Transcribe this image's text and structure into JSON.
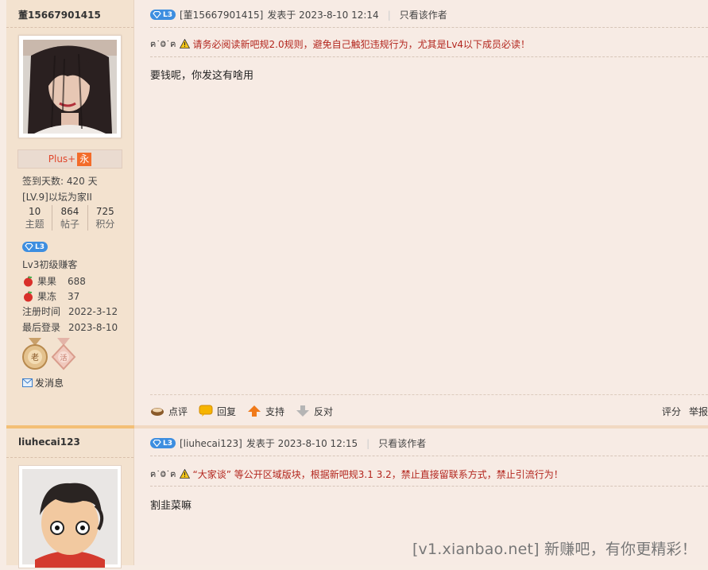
{
  "post1": {
    "username": "董15667901415",
    "plus_label": "Plus+",
    "plus_badge": "永",
    "signin_days": "签到天数: 420 天",
    "rank": "[LV.9]以坛为家II",
    "stats": [
      {
        "value": "10",
        "label": "主题"
      },
      {
        "value": "864",
        "label": "帖子"
      },
      {
        "value": "725",
        "label": "积分"
      }
    ],
    "level_badge": "L3",
    "level_name": "Lv3初级赚客",
    "guoguo_label": "果果",
    "guoguo_value": "688",
    "guodong_label": "果冻",
    "guodong_value": "37",
    "register_label": "注册时间",
    "register_value": "2022-3-12",
    "last_login_label": "最后登录",
    "last_login_value": "2023-8-10",
    "send_message": "发消息",
    "header_author": "[董15667901415]",
    "header_posted": "发表于 2023-8-10 12:14",
    "only_author": "只看该作者",
    "notice_face": "ฅ˙Ⱉ˙ฅ",
    "notice_text": "请务必阅读新吧规2.0规则，避免自己触犯违规行为，尤其是Lv4以下成员必读！",
    "content": "要钱呢，你发这有啥用",
    "actions": {
      "comment": "点评",
      "reply": "回复",
      "support": "支持",
      "oppose": "反对",
      "rate": "评分",
      "report": "举报"
    }
  },
  "post2": {
    "username": "liuhecai123",
    "level_badge": "L3",
    "header_author": "[liuhecai123]",
    "header_posted": "发表于 2023-8-10 12:15",
    "only_author": "只看该作者",
    "notice_face": "ฅ˙Ⱉ˙ฅ",
    "notice_text": "“大家谈” 等公开区域版块，根据新吧规3.1 3.2，禁止直接留联系方式，禁止引流行为！",
    "content": "割韭菜嘛"
  },
  "watermark": "[v1.xianbao.net] 新赚吧，有你更精彩！",
  "colors": {
    "page_bg": "#f7ebe4",
    "sidebar_bg": "#f3e2cf",
    "badge_blue": "#3d8ee0",
    "notice_red": "#b3261e",
    "plus_red": "#e0472c",
    "divider_orange": "#f3bf76"
  }
}
